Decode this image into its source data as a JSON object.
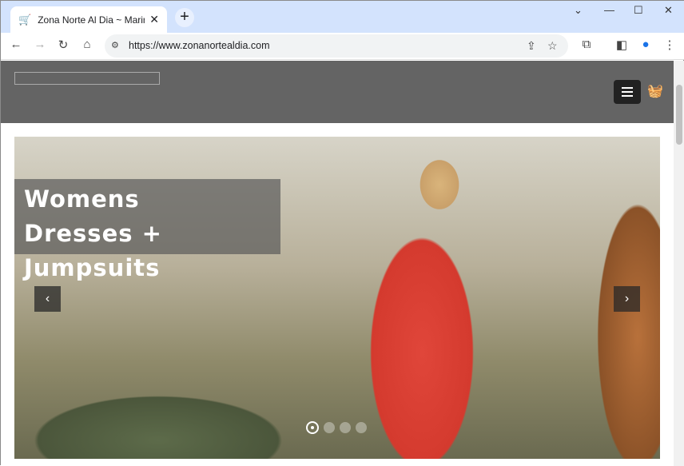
{
  "browser": {
    "tab_title": "Zona Norte Al Dia ~ Marine Layer",
    "url": "https://www.zonanortealdia.com",
    "new_tab": "+",
    "close": "✕"
  },
  "site": {
    "hero": {
      "caption_line1": "Womens",
      "caption_line2": "Dresses + Jumpsuits",
      "slide_count": 4,
      "active_slide": 1
    }
  },
  "icons": {
    "prev": "‹",
    "next": "›"
  }
}
